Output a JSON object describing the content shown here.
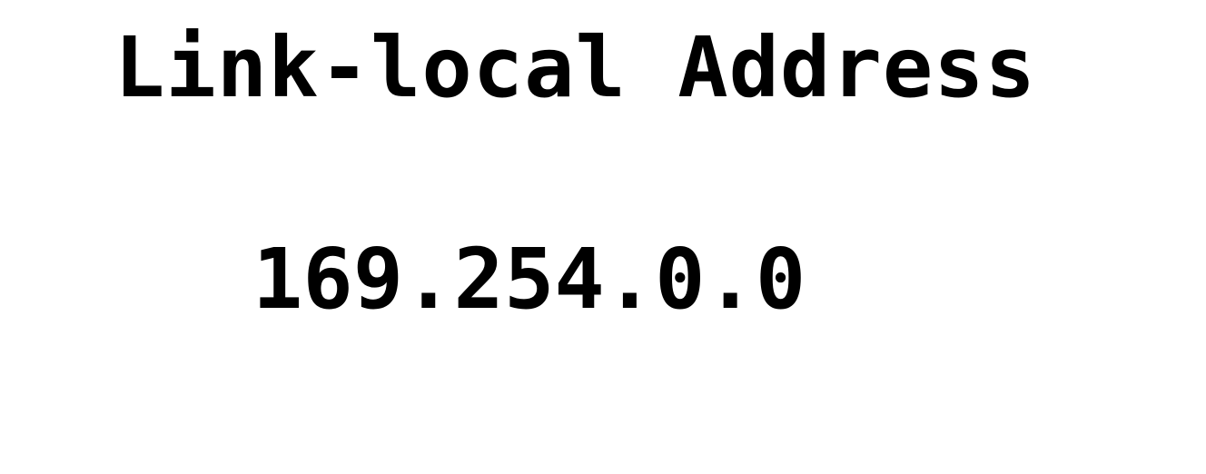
{
  "title": "Link-local Address",
  "address": "169.254.0.0",
  "colors": {
    "background": "#ffffff",
    "text": "#000000"
  }
}
